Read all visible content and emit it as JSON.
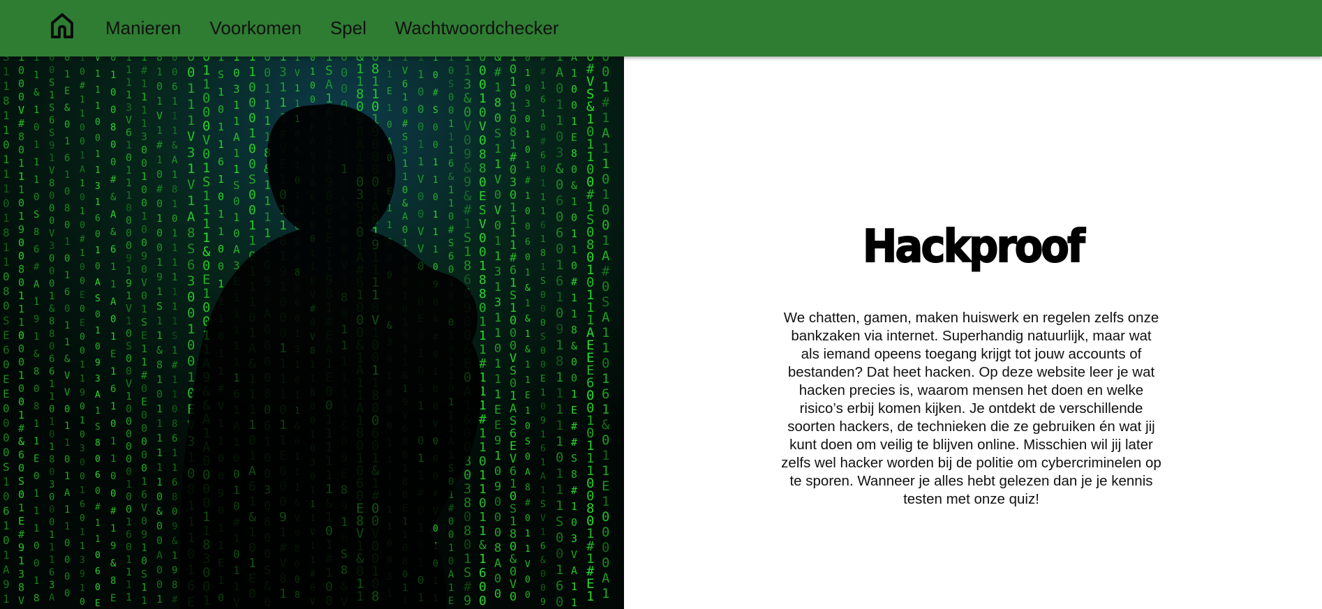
{
  "nav": {
    "home_icon": "home-icon",
    "items": [
      {
        "label": "Manieren"
      },
      {
        "label": "Voorkomen"
      },
      {
        "label": "Spel"
      },
      {
        "label": "Wachtwoordchecker"
      }
    ]
  },
  "hero": {
    "image": "hacker-silhouette-matrix-code-photo",
    "code_glyphs": [
      "0",
      "1",
      "8",
      "0",
      "1",
      "1",
      "0",
      "6",
      "1",
      "0",
      "#",
      "1",
      "0",
      "S",
      "9",
      "1",
      "0",
      "&",
      "1",
      "0",
      "1",
      "V",
      "0",
      "1",
      "A",
      "E",
      "1",
      "0",
      "3",
      "1"
    ]
  },
  "main": {
    "title": "Hackproof",
    "intro": "We chatten, gamen, maken huiswerk en regelen zelfs onze bankzaken via internet. Superhandig natuurlijk, maar wat als iemand opeens toegang krijgt tot jouw accounts of bestanden? Dat heet hacken. Op deze website leer je wat hacken precies is, waarom mensen het doen en welke risico’s erbij komen kijken. Je ontdekt de verschillende soorten hackers, de technieken die ze gebruiken én wat jij kunt doen om veilig te blijven online. Misschien wil jij later zelfs wel hacker worden bij de politie om cybercriminelen op te sporen. Wanneer je alles hebt gelezen dan je je kennis testen met onze quiz!"
  },
  "colors": {
    "navbar": "#2e7d32",
    "matrix_green": "#2bd62b",
    "background": "#ffffff"
  }
}
